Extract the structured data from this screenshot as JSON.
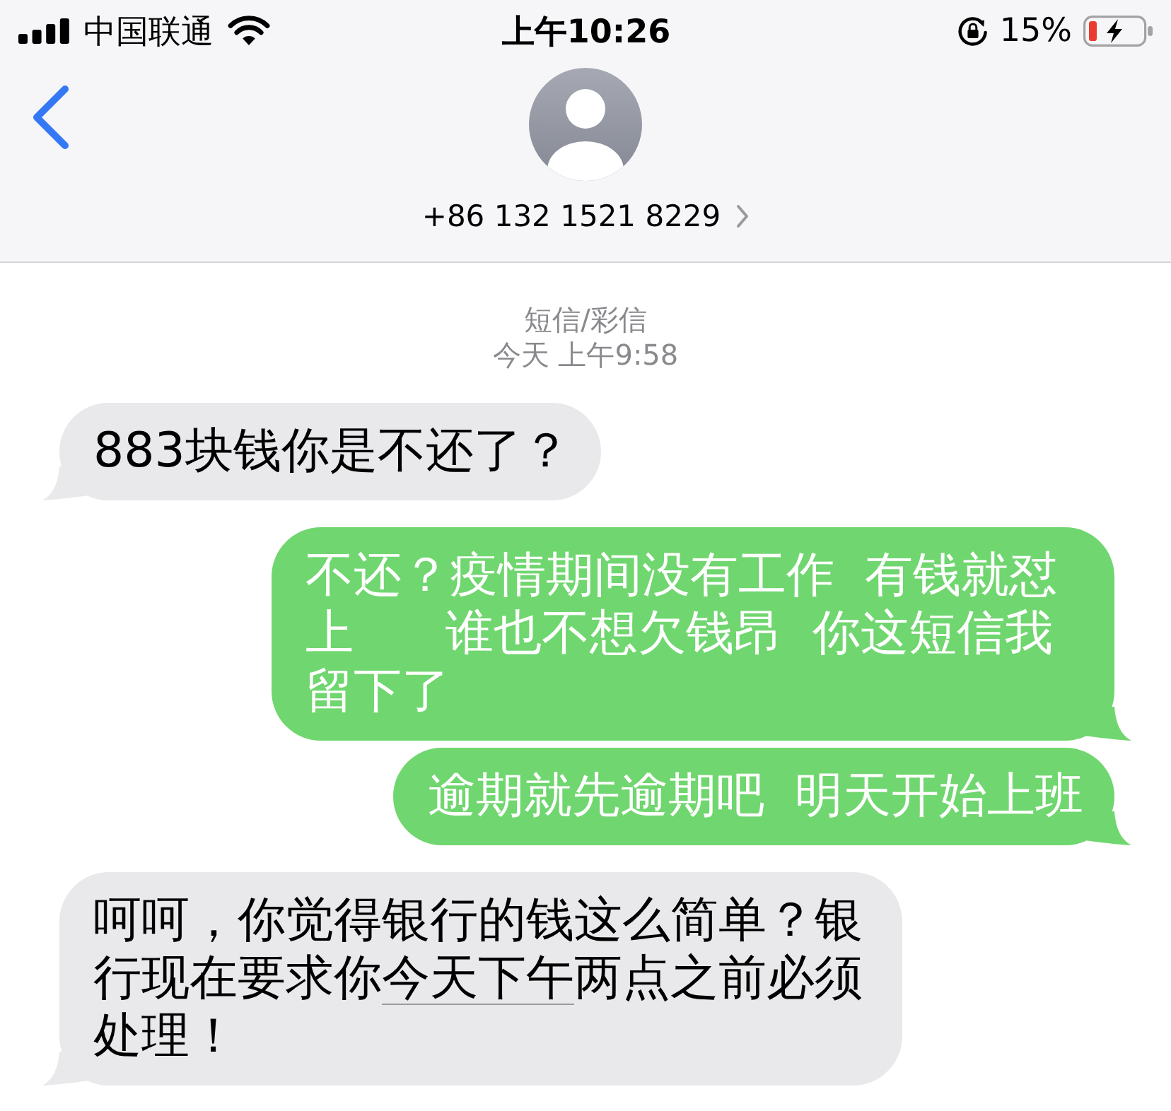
{
  "status_bar": {
    "carrier": "中国联通",
    "time": "上午10:26",
    "battery": "15%"
  },
  "contact": {
    "number": "+86 132 1521 8229"
  },
  "thread": {
    "service": "短信/彩信",
    "timestamp": "今天 上午9:58"
  },
  "messages": [
    {
      "kind": "incoming",
      "parts": [
        {
          "kind": "plain",
          "text": "883块钱你是不还了？"
        }
      ]
    },
    {
      "kind": "outgoing",
      "parts": [
        {
          "kind": "plain",
          "text": "不还？疫情期间没有工作  有钱就怼上      谁也不想欠钱昂  你这短信我留下了"
        }
      ]
    },
    {
      "kind": "outgoing",
      "parts": [
        {
          "kind": "plain",
          "text": "逾期就先逾期吧  明天开始上班"
        }
      ]
    },
    {
      "kind": "incoming",
      "parts": [
        {
          "kind": "plain",
          "text": "呵呵，你觉得银行的钱这么简单？银行现在要求你"
        },
        {
          "kind": "link",
          "text": "今天下午"
        },
        {
          "kind": "plain",
          "text": "两点之前必须处理！"
        }
      ]
    }
  ]
}
